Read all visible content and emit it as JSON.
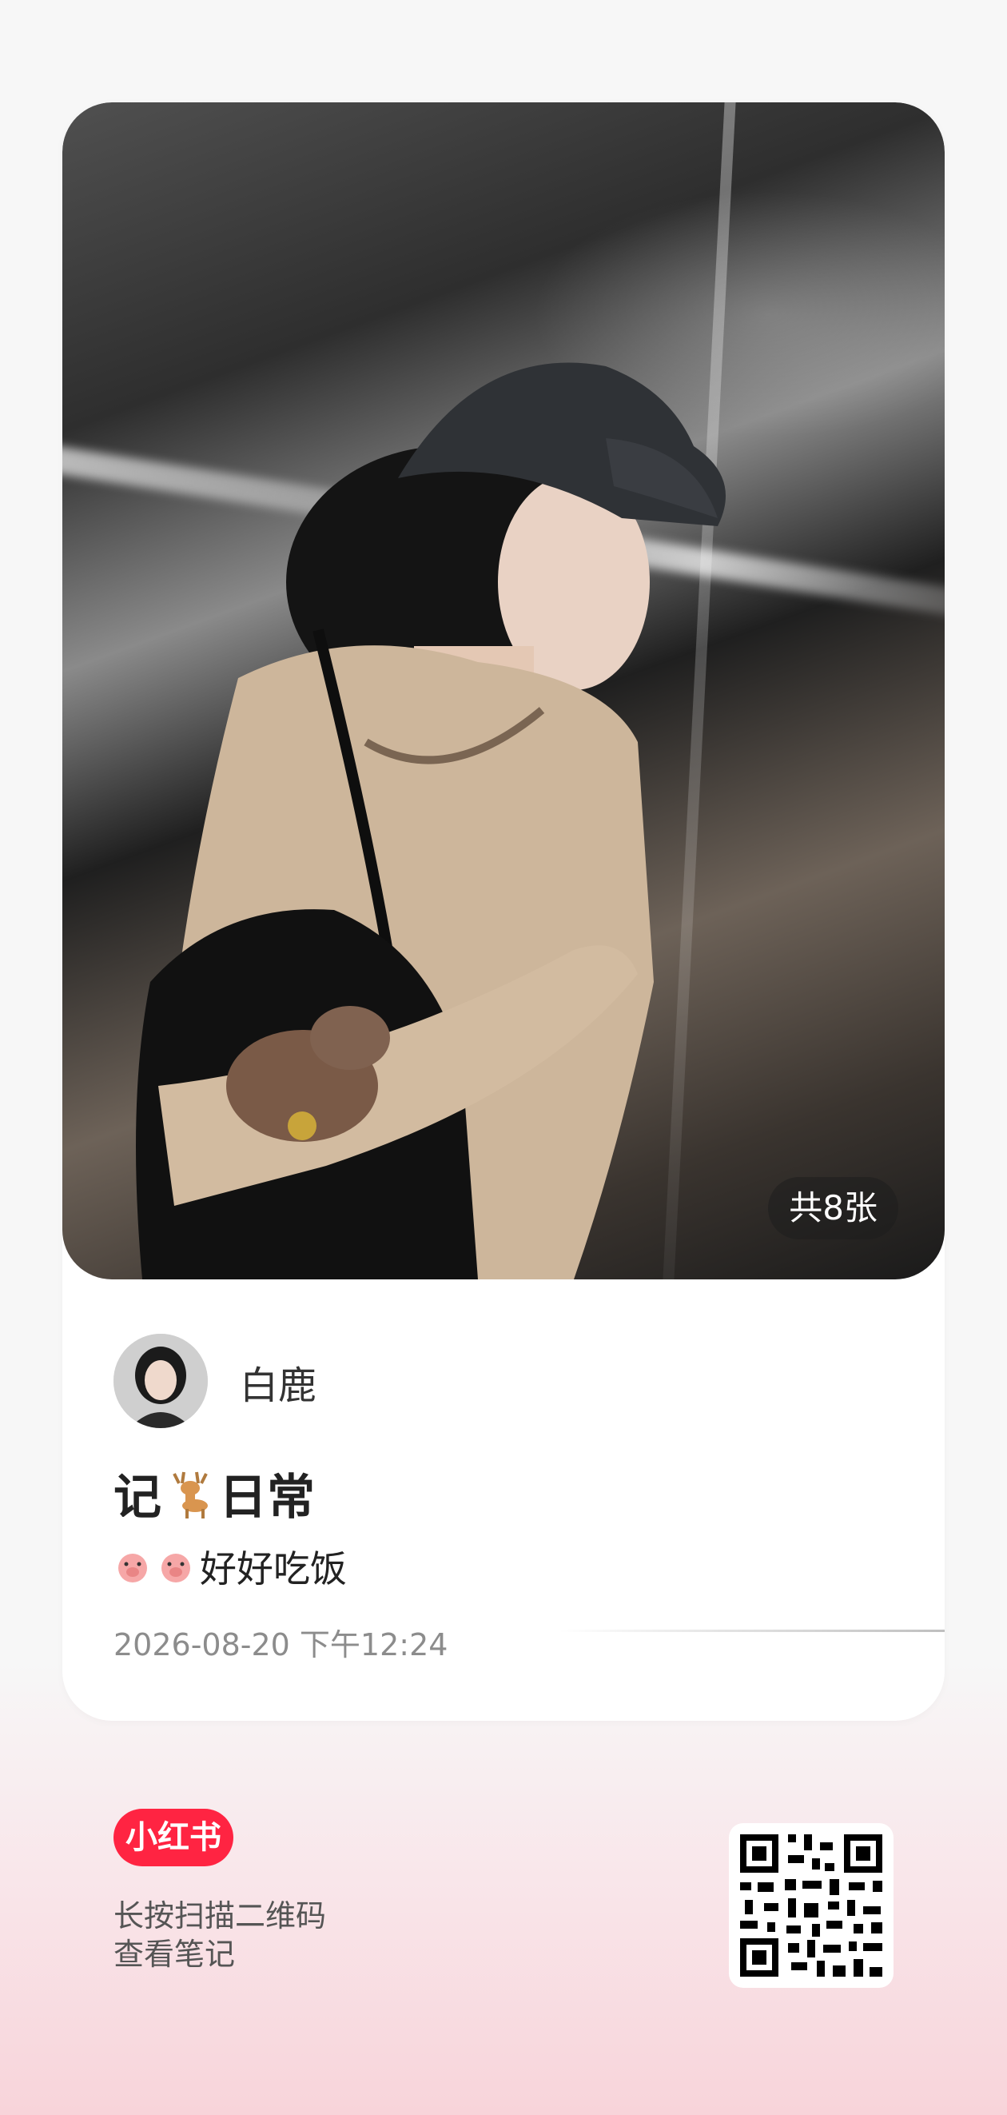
{
  "photo": {
    "count_label": "共8张"
  },
  "author": {
    "name": "白鹿"
  },
  "note": {
    "title": "记",
    "title_suffix": "日常",
    "title_emoji": "deer",
    "desc_emojis": [
      "pig",
      "pig"
    ],
    "description": "好好吃饭",
    "timestamp": "2026-08-20 下午12:24"
  },
  "footer": {
    "app_name": "小红书",
    "hint_line1": "长按扫描二维码",
    "hint_line2": "查看笔记"
  },
  "colors": {
    "brand": "#ff2442",
    "card_bg": "#ffffff",
    "text_primary": "#222222",
    "text_secondary": "#8c8c8c"
  }
}
